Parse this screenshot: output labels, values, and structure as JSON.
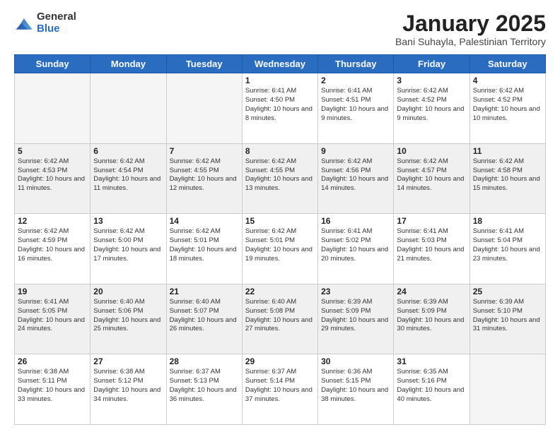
{
  "logo": {
    "general": "General",
    "blue": "Blue"
  },
  "header": {
    "month": "January 2025",
    "location": "Bani Suhayla, Palestinian Territory"
  },
  "days_of_week": [
    "Sunday",
    "Monday",
    "Tuesday",
    "Wednesday",
    "Thursday",
    "Friday",
    "Saturday"
  ],
  "weeks": [
    [
      {
        "day": "",
        "sunrise": "",
        "sunset": "",
        "daylight": "",
        "empty": true
      },
      {
        "day": "",
        "sunrise": "",
        "sunset": "",
        "daylight": "",
        "empty": true
      },
      {
        "day": "",
        "sunrise": "",
        "sunset": "",
        "daylight": "",
        "empty": true
      },
      {
        "day": "1",
        "sunrise": "Sunrise: 6:41 AM",
        "sunset": "Sunset: 4:50 PM",
        "daylight": "Daylight: 10 hours and 8 minutes."
      },
      {
        "day": "2",
        "sunrise": "Sunrise: 6:41 AM",
        "sunset": "Sunset: 4:51 PM",
        "daylight": "Daylight: 10 hours and 9 minutes."
      },
      {
        "day": "3",
        "sunrise": "Sunrise: 6:42 AM",
        "sunset": "Sunset: 4:52 PM",
        "daylight": "Daylight: 10 hours and 9 minutes."
      },
      {
        "day": "4",
        "sunrise": "Sunrise: 6:42 AM",
        "sunset": "Sunset: 4:52 PM",
        "daylight": "Daylight: 10 hours and 10 minutes."
      }
    ],
    [
      {
        "day": "5",
        "sunrise": "Sunrise: 6:42 AM",
        "sunset": "Sunset: 4:53 PM",
        "daylight": "Daylight: 10 hours and 11 minutes."
      },
      {
        "day": "6",
        "sunrise": "Sunrise: 6:42 AM",
        "sunset": "Sunset: 4:54 PM",
        "daylight": "Daylight: 10 hours and 11 minutes."
      },
      {
        "day": "7",
        "sunrise": "Sunrise: 6:42 AM",
        "sunset": "Sunset: 4:55 PM",
        "daylight": "Daylight: 10 hours and 12 minutes."
      },
      {
        "day": "8",
        "sunrise": "Sunrise: 6:42 AM",
        "sunset": "Sunset: 4:55 PM",
        "daylight": "Daylight: 10 hours and 13 minutes."
      },
      {
        "day": "9",
        "sunrise": "Sunrise: 6:42 AM",
        "sunset": "Sunset: 4:56 PM",
        "daylight": "Daylight: 10 hours and 14 minutes."
      },
      {
        "day": "10",
        "sunrise": "Sunrise: 6:42 AM",
        "sunset": "Sunset: 4:57 PM",
        "daylight": "Daylight: 10 hours and 14 minutes."
      },
      {
        "day": "11",
        "sunrise": "Sunrise: 6:42 AM",
        "sunset": "Sunset: 4:58 PM",
        "daylight": "Daylight: 10 hours and 15 minutes."
      }
    ],
    [
      {
        "day": "12",
        "sunrise": "Sunrise: 6:42 AM",
        "sunset": "Sunset: 4:59 PM",
        "daylight": "Daylight: 10 hours and 16 minutes."
      },
      {
        "day": "13",
        "sunrise": "Sunrise: 6:42 AM",
        "sunset": "Sunset: 5:00 PM",
        "daylight": "Daylight: 10 hours and 17 minutes."
      },
      {
        "day": "14",
        "sunrise": "Sunrise: 6:42 AM",
        "sunset": "Sunset: 5:01 PM",
        "daylight": "Daylight: 10 hours and 18 minutes."
      },
      {
        "day": "15",
        "sunrise": "Sunrise: 6:42 AM",
        "sunset": "Sunset: 5:01 PM",
        "daylight": "Daylight: 10 hours and 19 minutes."
      },
      {
        "day": "16",
        "sunrise": "Sunrise: 6:41 AM",
        "sunset": "Sunset: 5:02 PM",
        "daylight": "Daylight: 10 hours and 20 minutes."
      },
      {
        "day": "17",
        "sunrise": "Sunrise: 6:41 AM",
        "sunset": "Sunset: 5:03 PM",
        "daylight": "Daylight: 10 hours and 21 minutes."
      },
      {
        "day": "18",
        "sunrise": "Sunrise: 6:41 AM",
        "sunset": "Sunset: 5:04 PM",
        "daylight": "Daylight: 10 hours and 23 minutes."
      }
    ],
    [
      {
        "day": "19",
        "sunrise": "Sunrise: 6:41 AM",
        "sunset": "Sunset: 5:05 PM",
        "daylight": "Daylight: 10 hours and 24 minutes."
      },
      {
        "day": "20",
        "sunrise": "Sunrise: 6:40 AM",
        "sunset": "Sunset: 5:06 PM",
        "daylight": "Daylight: 10 hours and 25 minutes."
      },
      {
        "day": "21",
        "sunrise": "Sunrise: 6:40 AM",
        "sunset": "Sunset: 5:07 PM",
        "daylight": "Daylight: 10 hours and 26 minutes."
      },
      {
        "day": "22",
        "sunrise": "Sunrise: 6:40 AM",
        "sunset": "Sunset: 5:08 PM",
        "daylight": "Daylight: 10 hours and 27 minutes."
      },
      {
        "day": "23",
        "sunrise": "Sunrise: 6:39 AM",
        "sunset": "Sunset: 5:09 PM",
        "daylight": "Daylight: 10 hours and 29 minutes."
      },
      {
        "day": "24",
        "sunrise": "Sunrise: 6:39 AM",
        "sunset": "Sunset: 5:09 PM",
        "daylight": "Daylight: 10 hours and 30 minutes."
      },
      {
        "day": "25",
        "sunrise": "Sunrise: 6:39 AM",
        "sunset": "Sunset: 5:10 PM",
        "daylight": "Daylight: 10 hours and 31 minutes."
      }
    ],
    [
      {
        "day": "26",
        "sunrise": "Sunrise: 6:38 AM",
        "sunset": "Sunset: 5:11 PM",
        "daylight": "Daylight: 10 hours and 33 minutes."
      },
      {
        "day": "27",
        "sunrise": "Sunrise: 6:38 AM",
        "sunset": "Sunset: 5:12 PM",
        "daylight": "Daylight: 10 hours and 34 minutes."
      },
      {
        "day": "28",
        "sunrise": "Sunrise: 6:37 AM",
        "sunset": "Sunset: 5:13 PM",
        "daylight": "Daylight: 10 hours and 36 minutes."
      },
      {
        "day": "29",
        "sunrise": "Sunrise: 6:37 AM",
        "sunset": "Sunset: 5:14 PM",
        "daylight": "Daylight: 10 hours and 37 minutes."
      },
      {
        "day": "30",
        "sunrise": "Sunrise: 6:36 AM",
        "sunset": "Sunset: 5:15 PM",
        "daylight": "Daylight: 10 hours and 38 minutes."
      },
      {
        "day": "31",
        "sunrise": "Sunrise: 6:35 AM",
        "sunset": "Sunset: 5:16 PM",
        "daylight": "Daylight: 10 hours and 40 minutes."
      },
      {
        "day": "",
        "sunrise": "",
        "sunset": "",
        "daylight": "",
        "empty": true
      }
    ]
  ]
}
